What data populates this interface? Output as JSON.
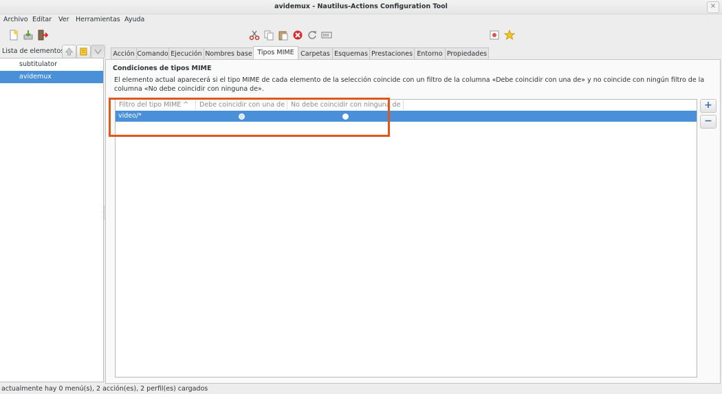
{
  "window": {
    "title": "avidemux - Nautilus-Actions Configuration Tool",
    "close_glyph": "✕"
  },
  "menubar": {
    "items": [
      "Archivo",
      "Editar",
      "Ver",
      "Herramientas",
      "Ayuda"
    ]
  },
  "toolbar": {
    "icons": [
      "new-item-icon",
      "save-icon",
      "quit-icon",
      "cut-icon",
      "copy-icon",
      "paste-icon",
      "delete-icon",
      "reload-icon",
      "rename-icon",
      "preferences-icon",
      "star-icon"
    ]
  },
  "left_pane": {
    "header_label": "Lista de elementos:",
    "items": [
      {
        "label": "subtitulator",
        "selected": false
      },
      {
        "label": "avidemux",
        "selected": true
      }
    ]
  },
  "tabs": [
    {
      "label": "Acción",
      "active": false
    },
    {
      "label": "Comando",
      "active": false
    },
    {
      "label": "Ejecución",
      "active": false
    },
    {
      "label": "Nombres base",
      "active": false
    },
    {
      "label": "Tipos MIME",
      "active": true
    },
    {
      "label": "Carpetas",
      "active": false
    },
    {
      "label": "Esquemas",
      "active": false
    },
    {
      "label": "Prestaciones",
      "active": false
    },
    {
      "label": "Entorno",
      "active": false
    },
    {
      "label": "Propiedades",
      "active": false
    }
  ],
  "mime_panel": {
    "section_title": "Condiciones de tipos MIME",
    "description": "El elemento actual aparecerá si el tipo MIME de cada elemento de la selección coincide con un filtro de la columna «Debe coincidir con una de» y no coincide con ningún filtro de la columna «No debe coincidir con ninguna de».",
    "columns": [
      "Filtro del tipo MIME ^",
      "Debe coincidir con una de",
      "No debe coincidir con ninguna de"
    ],
    "rows": [
      {
        "filter": "video/*",
        "must_match": true,
        "must_not_match": false
      }
    ],
    "add_button": "+",
    "remove_button": "−"
  },
  "colors": {
    "selection": "#4a90d9",
    "highlight_box": "#e2561b"
  },
  "statusbar": {
    "text": "actualmente hay 0 menú(s), 2 acción(es), 2 perfil(es) cargados"
  }
}
